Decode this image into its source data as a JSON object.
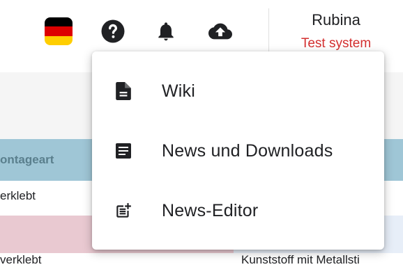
{
  "header": {
    "flag_colors": [
      "#000000",
      "#dd0000",
      "#ffce00"
    ],
    "help_icon": "help-circle-icon",
    "notifications_icon": "bell-icon",
    "upload_icon": "cloud-upload-icon",
    "user": {
      "name": "Rubina",
      "environment": "Test system"
    },
    "accent_red": "#d32f2f"
  },
  "table": {
    "header_cell": "ontageart",
    "row1_cell": "erklebt",
    "row3_left": "verklebt",
    "row3_right": "Kunststoff mit Metallsti"
  },
  "menu": {
    "items": [
      {
        "label": "Wiki",
        "icon": "document-icon"
      },
      {
        "label": "News und Downloads",
        "icon": "article-icon"
      },
      {
        "label": "News-Editor",
        "icon": "post-add-icon"
      }
    ]
  }
}
